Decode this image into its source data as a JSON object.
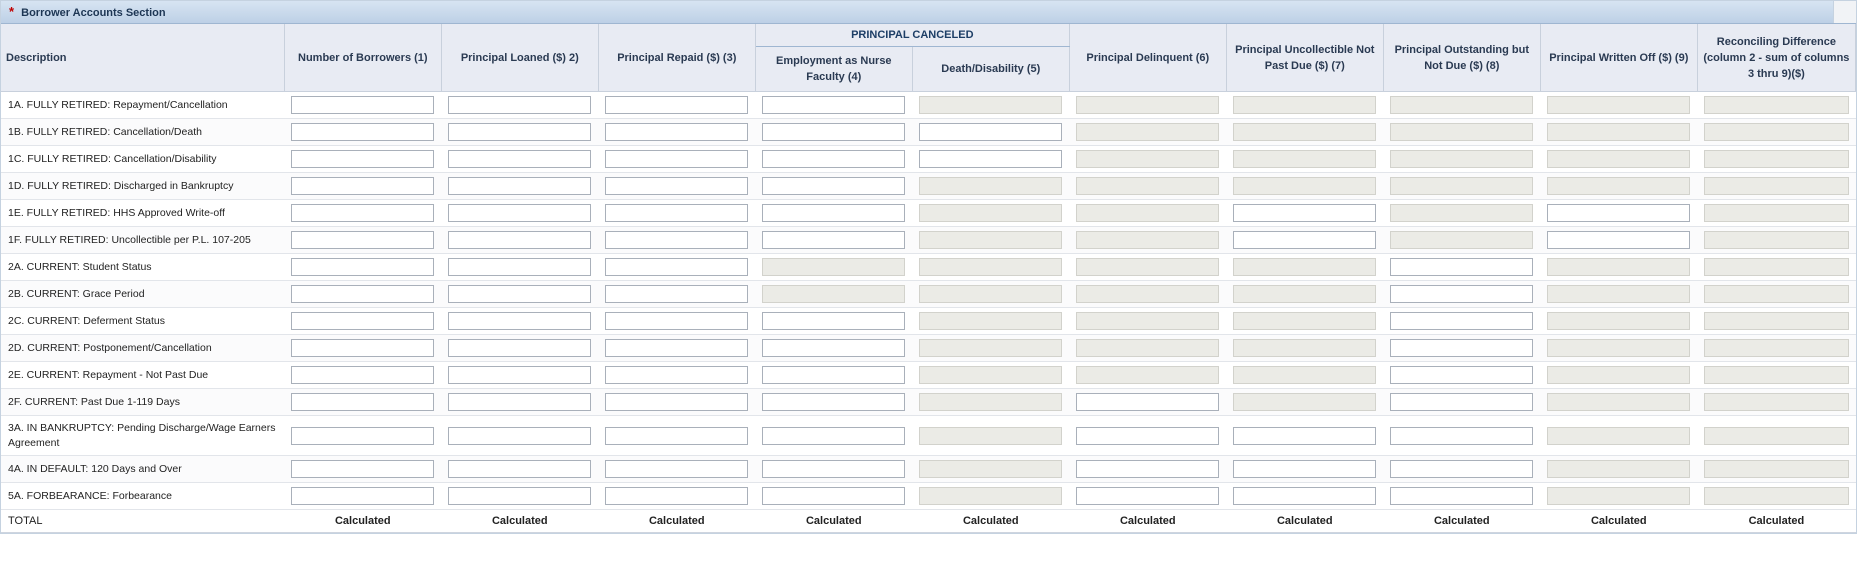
{
  "section": {
    "required_marker": "*",
    "title": "Borrower Accounts Section"
  },
  "columns": {
    "description": "Description",
    "col1": "Number of Borrowers (1)",
    "col2": "Principal Loaned ($) 2)",
    "col3": "Principal Repaid ($) (3)",
    "group": "PRINCIPAL CANCELED",
    "col4": "Employment as Nurse Faculty (4)",
    "col5": "Death/Disability (5)",
    "col6": "Principal Delinquent (6)",
    "col7": "Principal Uncollectible Not Past Due ($) (7)",
    "col8": "Principal Outstanding but Not Due ($) (8)",
    "col9": "Principal Written Off ($) (9)",
    "col10": "Reconciling Difference (column 2 - sum of columns 3 thru 9)($)"
  },
  "rows": [
    {
      "label": "1A. FULLY RETIRED: Repayment/Cancellation",
      "enabled": [
        1,
        1,
        1,
        1,
        0,
        0,
        0,
        0,
        0,
        0
      ]
    },
    {
      "label": "1B. FULLY RETIRED: Cancellation/Death",
      "enabled": [
        1,
        1,
        1,
        1,
        1,
        0,
        0,
        0,
        0,
        0
      ]
    },
    {
      "label": "1C. FULLY RETIRED: Cancellation/Disability",
      "enabled": [
        1,
        1,
        1,
        1,
        1,
        0,
        0,
        0,
        0,
        0
      ]
    },
    {
      "label": "1D. FULLY RETIRED: Discharged in Bankruptcy",
      "enabled": [
        1,
        1,
        1,
        1,
        0,
        0,
        0,
        0,
        0,
        0
      ]
    },
    {
      "label": "1E. FULLY RETIRED: HHS Approved Write-off",
      "enabled": [
        1,
        1,
        1,
        1,
        0,
        0,
        1,
        0,
        1,
        0
      ]
    },
    {
      "label": "1F. FULLY RETIRED: Uncollectible per P.L. 107-205",
      "enabled": [
        1,
        1,
        1,
        1,
        0,
        0,
        1,
        0,
        1,
        0
      ]
    },
    {
      "label": "2A. CURRENT: Student Status",
      "enabled": [
        1,
        1,
        1,
        0,
        0,
        0,
        0,
        1,
        0,
        0
      ]
    },
    {
      "label": "2B. CURRENT: Grace Period",
      "enabled": [
        1,
        1,
        1,
        0,
        0,
        0,
        0,
        1,
        0,
        0
      ]
    },
    {
      "label": "2C. CURRENT: Deferment Status",
      "enabled": [
        1,
        1,
        1,
        1,
        0,
        0,
        0,
        1,
        0,
        0
      ]
    },
    {
      "label": "2D. CURRENT: Postponement/Cancellation",
      "enabled": [
        1,
        1,
        1,
        1,
        0,
        0,
        0,
        1,
        0,
        0
      ]
    },
    {
      "label": "2E. CURRENT: Repayment - Not Past Due",
      "enabled": [
        1,
        1,
        1,
        1,
        0,
        0,
        0,
        1,
        0,
        0
      ]
    },
    {
      "label": "2F. CURRENT: Past Due 1-119 Days",
      "enabled": [
        1,
        1,
        1,
        1,
        0,
        1,
        0,
        1,
        0,
        0
      ]
    },
    {
      "label": "3A. IN BANKRUPTCY: Pending Discharge/Wage Earners Agreement",
      "enabled": [
        1,
        1,
        1,
        1,
        0,
        1,
        1,
        1,
        0,
        0
      ],
      "tall": true
    },
    {
      "label": "4A. IN DEFAULT: 120 Days and Over",
      "enabled": [
        1,
        1,
        1,
        1,
        0,
        1,
        1,
        1,
        0,
        0
      ]
    },
    {
      "label": "5A. FORBEARANCE: Forbearance",
      "enabled": [
        1,
        1,
        1,
        1,
        0,
        1,
        1,
        1,
        0,
        0
      ]
    }
  ],
  "total": {
    "label": "TOTAL",
    "calculated": "Calculated"
  }
}
